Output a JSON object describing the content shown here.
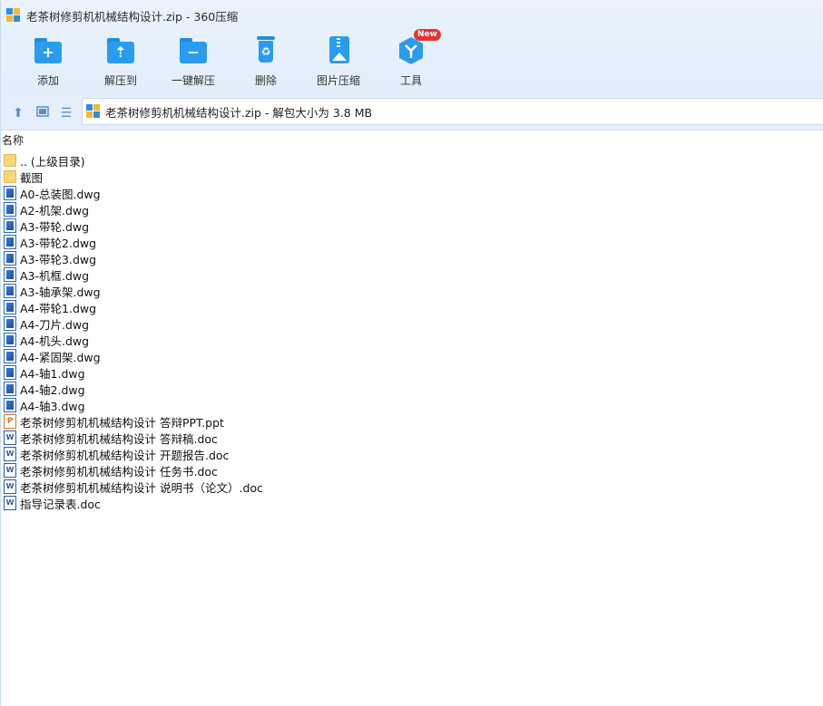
{
  "window": {
    "title": "老茶树修剪机机械结构设计.zip - 360压缩"
  },
  "toolbar": {
    "add": "添加",
    "extract_to": "解压到",
    "one_click_extract": "一键解压",
    "delete": "删除",
    "image_compress": "图片压缩",
    "tools": "工具",
    "new_badge": "New"
  },
  "address": {
    "text": "老茶树修剪机机械结构设计.zip - 解包大小为 3.8 MB"
  },
  "columns": {
    "name": "名称"
  },
  "files": [
    {
      "name": ".. (上级目录)",
      "type": "folder"
    },
    {
      "name": "截图",
      "type": "folder"
    },
    {
      "name": "A0-总装图.dwg",
      "type": "dwg"
    },
    {
      "name": "A2-机架.dwg",
      "type": "dwg"
    },
    {
      "name": "A3-带轮.dwg",
      "type": "dwg"
    },
    {
      "name": "A3-带轮2.dwg",
      "type": "dwg"
    },
    {
      "name": "A3-带轮3.dwg",
      "type": "dwg"
    },
    {
      "name": "A3-机框.dwg",
      "type": "dwg"
    },
    {
      "name": "A3-轴承架.dwg",
      "type": "dwg"
    },
    {
      "name": "A4-带轮1.dwg",
      "type": "dwg"
    },
    {
      "name": "A4-刀片.dwg",
      "type": "dwg"
    },
    {
      "name": "A4-机头.dwg",
      "type": "dwg"
    },
    {
      "name": "A4-紧固架.dwg",
      "type": "dwg"
    },
    {
      "name": "A4-轴1.dwg",
      "type": "dwg"
    },
    {
      "name": "A4-轴2.dwg",
      "type": "dwg"
    },
    {
      "name": "A4-轴3.dwg",
      "type": "dwg"
    },
    {
      "name": "老茶树修剪机机械结构设计 答辩PPT.ppt",
      "type": "ppt"
    },
    {
      "name": "老茶树修剪机机械结构设计 答辩稿.doc",
      "type": "doc"
    },
    {
      "name": "老茶树修剪机机械结构设计 开题报告.doc",
      "type": "doc"
    },
    {
      "name": "老茶树修剪机机械结构设计 任务书.doc",
      "type": "doc"
    },
    {
      "name": "老茶树修剪机机械结构设计 说明书（论文）.doc",
      "type": "doc"
    },
    {
      "name": "指导记录表.doc",
      "type": "doc"
    }
  ]
}
